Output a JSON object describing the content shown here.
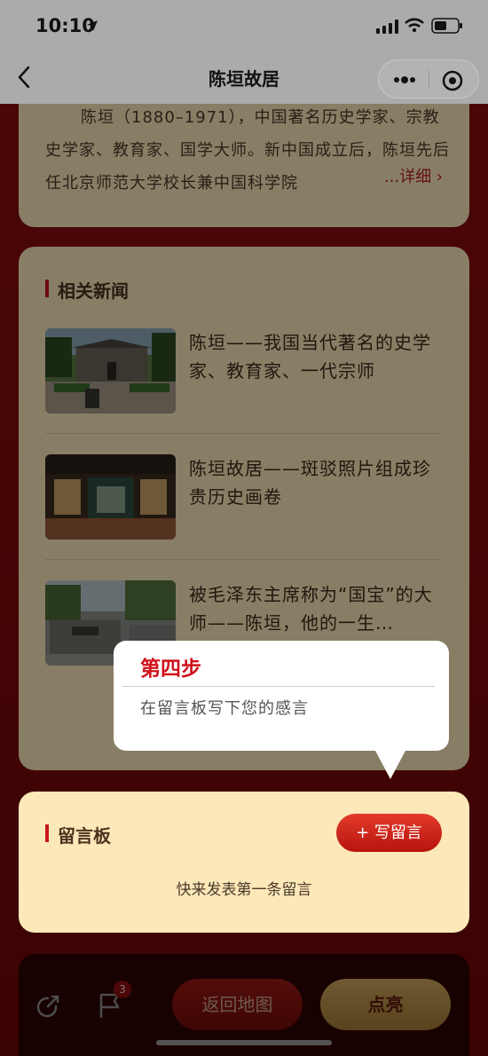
{
  "status_bar": {
    "time": "10:10"
  },
  "nav": {
    "title": "陈垣故居"
  },
  "intro": {
    "text": "陈垣（1880–1971），中国著名历史学家、宗教史学家、教育家、国学大师。新中国成立后，陈垣先后任北京师范大学校长兼中国科学院",
    "more_label": "...详细 ›"
  },
  "news": {
    "section_title": "相关新闻",
    "items": [
      {
        "title": "陈垣——我国当代著名的史学家、教育家、一代宗师"
      },
      {
        "title": "陈垣故居——斑驳照片组成珍贵历史画卷"
      },
      {
        "title": "被毛泽东主席称为“国宝”的大师——陈垣，他的一生…"
      }
    ]
  },
  "tooltip": {
    "title": "第四步",
    "body": "在留言板写下您的感言"
  },
  "board": {
    "section_title": "留言板",
    "write_label": "+ 写留言",
    "empty_text": "快来发表第一条留言"
  },
  "bottom_bar": {
    "badge_count": "3",
    "back_map_label": "返回地图",
    "light_label": "点亮"
  },
  "colors": {
    "accent_red": "#c8161d",
    "card_bg": "#f8e6b8",
    "gold": "#c9a35b"
  }
}
